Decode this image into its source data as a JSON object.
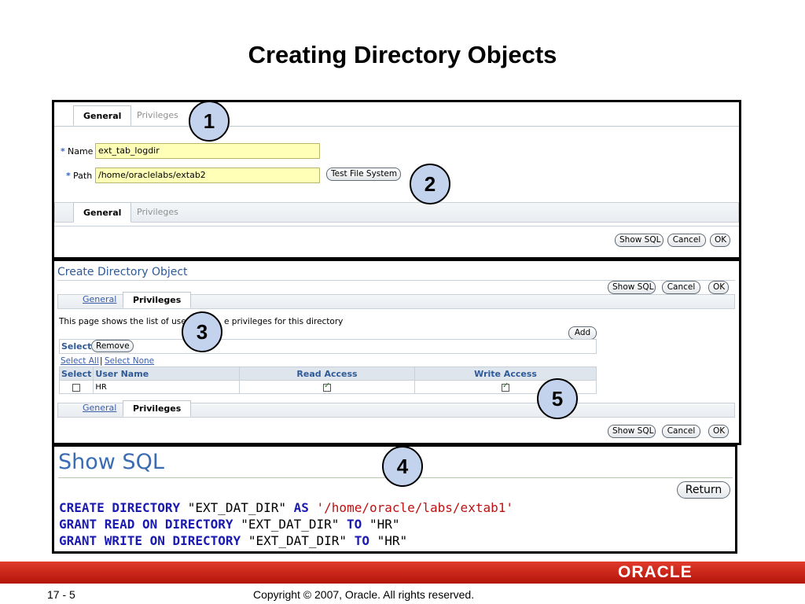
{
  "slide": {
    "title": "Creating Directory Objects"
  },
  "panel1": {
    "tabs_top": [
      "General",
      "Privileges"
    ],
    "name_label": "Name",
    "name_value": "ext_tab_logdir",
    "path_label": "Path",
    "path_value": "/home/oraclelabs/extab2",
    "required_mark": "*",
    "test_btn": "Test File System",
    "tabs_bottom": [
      "General",
      "Privileges"
    ],
    "buttons": [
      "Show SQL",
      "Cancel",
      "OK"
    ]
  },
  "panel2": {
    "title": "Create Directory Object",
    "buttons_top": [
      "Show SQL",
      "Cancel",
      "OK"
    ],
    "tabs_top": [
      "General",
      "Privileges"
    ],
    "description_start": "This page shows the list of user",
    "description_end": "e privileges for this directory",
    "add_btn": "Add",
    "select_label": "Select",
    "remove_btn": "Remove",
    "select_all": "Select All",
    "divider": "|",
    "select_none": "Select None",
    "columns": [
      "Select",
      "User Name",
      "Read Access",
      "Write Access"
    ],
    "rows": [
      {
        "user": "HR",
        "read": true,
        "write": true
      }
    ],
    "tabs_bottom": [
      "General",
      "Privileges"
    ],
    "buttons_bottom": [
      "Show SQL",
      "Cancel",
      "OK"
    ]
  },
  "panel3": {
    "title": "Show SQL",
    "return_btn": "Return",
    "sql": [
      [
        {
          "t": "CREATE DIRECTORY ",
          "c": "kw"
        },
        {
          "t": "\"EXT_DAT_DIR\" ",
          "c": "plain"
        },
        {
          "t": "AS ",
          "c": "kw"
        },
        {
          "t": "'/home/oracle/labs/extab1'",
          "c": "str"
        }
      ],
      [
        {
          "t": "GRANT READ ON DIRECTORY ",
          "c": "kw"
        },
        {
          "t": "\"EXT_DAT_DIR\" ",
          "c": "plain"
        },
        {
          "t": "TO ",
          "c": "kw"
        },
        {
          "t": "\"HR\"",
          "c": "plain"
        }
      ],
      [
        {
          "t": "GRANT WRITE ON DIRECTORY ",
          "c": "kw"
        },
        {
          "t": "\"EXT_DAT_DIR\" ",
          "c": "plain"
        },
        {
          "t": "TO ",
          "c": "kw"
        },
        {
          "t": "\"HR\"",
          "c": "plain"
        }
      ]
    ]
  },
  "callouts": [
    "1",
    "2",
    "3",
    "4",
    "5"
  ],
  "footer": {
    "page": "17 - 5",
    "copyright": "Copyright © 2007, Oracle. All rights reserved.",
    "logo": "ORACLE"
  },
  "colors": {
    "accent": "#c3d3ee",
    "brand": "#c8200f",
    "link": "#3a5ea8"
  }
}
